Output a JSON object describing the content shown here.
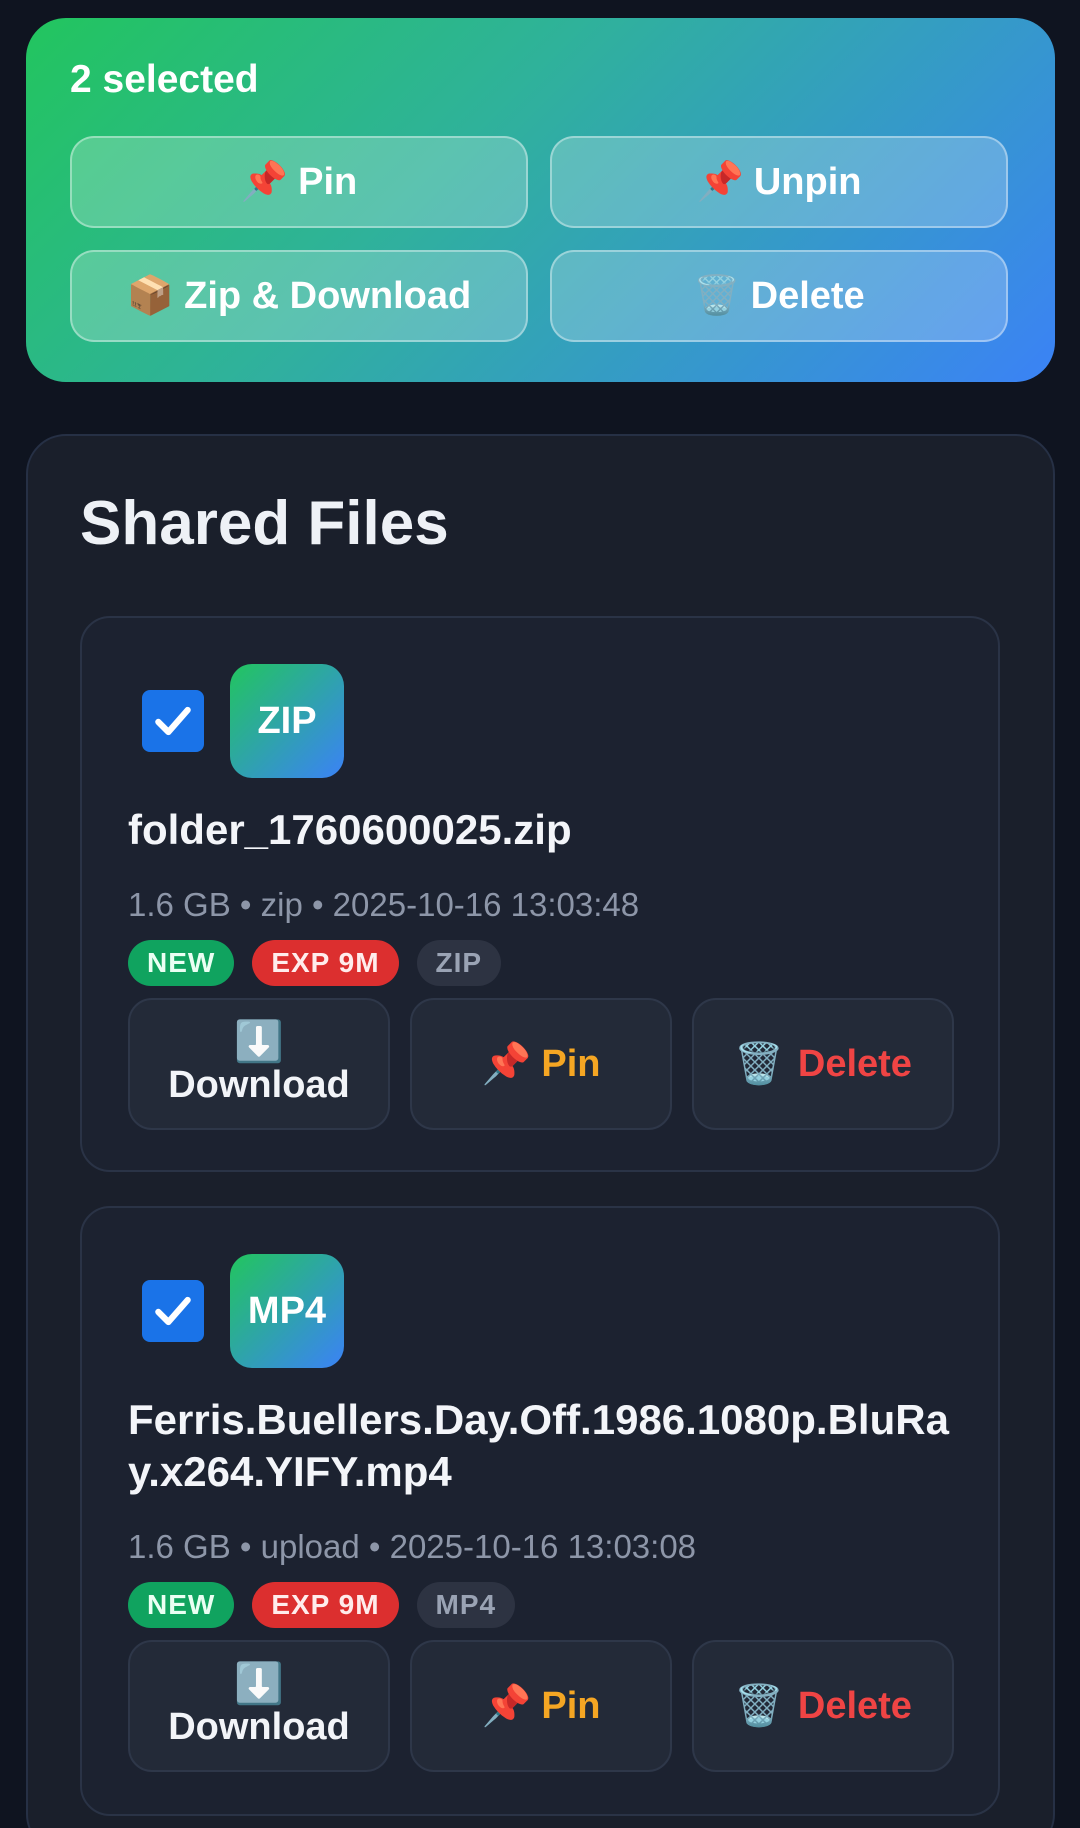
{
  "selection": {
    "count_text": "2 selected",
    "pin": {
      "icon": "📌",
      "label": "Pin"
    },
    "unpin": {
      "icon": "📌",
      "label": "Unpin"
    },
    "zip": {
      "icon": "📦",
      "label": "Zip & Download"
    },
    "delete": {
      "icon": "🗑️",
      "label": "Delete"
    }
  },
  "panel": {
    "title": "Shared Files",
    "files": [
      {
        "type_label": "ZIP",
        "name": "folder_1760600025.zip",
        "meta": "1.6 GB • zip • 2025-10-16 13:03:48",
        "badges": {
          "new": "NEW",
          "exp": "EXP 9M",
          "type": "ZIP"
        },
        "actions": {
          "download_icon": "⬇️",
          "download": "Download",
          "pin_icon": "📌",
          "pin": "Pin",
          "delete_icon": "🗑️",
          "delete": "Delete"
        },
        "checked": true
      },
      {
        "type_label": "MP4",
        "name": "Ferris.Buellers.Day.Off.1986.1080p.BluRay.x264.YIFY.mp4",
        "meta": "1.6 GB • upload • 2025-10-16 13:03:08",
        "badges": {
          "new": "NEW",
          "exp": "EXP 9M",
          "type": "MP4"
        },
        "actions": {
          "download_icon": "⬇️",
          "download": "Download",
          "pin_icon": "📌",
          "pin": "Pin",
          "delete_icon": "🗑️",
          "delete": "Delete"
        },
        "checked": true
      }
    ]
  },
  "colors": {
    "background": "#0f1420",
    "gradient_start": "#22c55e",
    "gradient_end": "#3b82f6",
    "checkbox": "#1a73e8",
    "pin_text": "#f5a623",
    "delete_text": "#ef4444",
    "badge_new": "#10a35f",
    "badge_exp": "#dc2f2f"
  },
  "icons": {
    "checkbox": "checkmark-icon",
    "pin": "pushpin-icon",
    "zip": "package-icon",
    "delete": "trash-icon",
    "download": "down-arrow-icon"
  }
}
